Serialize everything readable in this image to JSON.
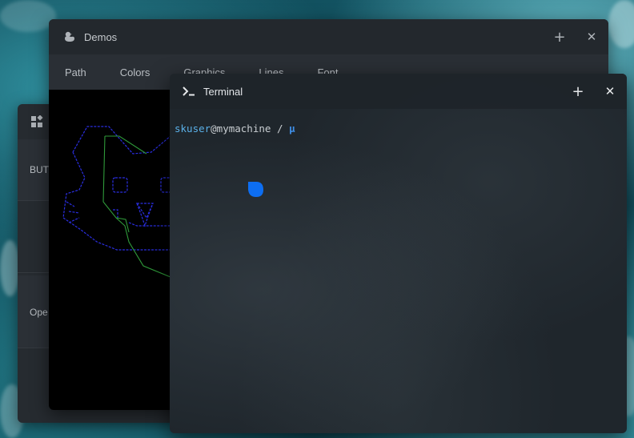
{
  "desktop": {
    "background": "ocean-waves"
  },
  "back_window": {
    "icon": "widgets-icon",
    "section_button": "BUT",
    "section_open": "Ope"
  },
  "demos_window": {
    "icon": "duck-icon",
    "title": "Demos",
    "add_label": "+",
    "close_label": "✕",
    "tabs": [
      {
        "label": "Path"
      },
      {
        "label": "Colors"
      },
      {
        "label": "Graphics"
      },
      {
        "label": "Lines"
      },
      {
        "label": "Font"
      }
    ],
    "drawing": "cat-face-path"
  },
  "terminal_window": {
    "icon": "terminal-prompt-icon",
    "title": "Terminal",
    "add_label": "+",
    "close_label": "✕",
    "prompt": {
      "user": "skuser",
      "host": "@mymachine",
      "cwd": " / ",
      "symbol": "µ"
    }
  },
  "colors": {
    "accent_blue": "#3f8fe8",
    "prompt_user": "#5ab0e8",
    "cursor_blob": "#0d6ef2",
    "drawing_blue": "#2a2ee0",
    "drawing_green": "#2f9a3a"
  }
}
